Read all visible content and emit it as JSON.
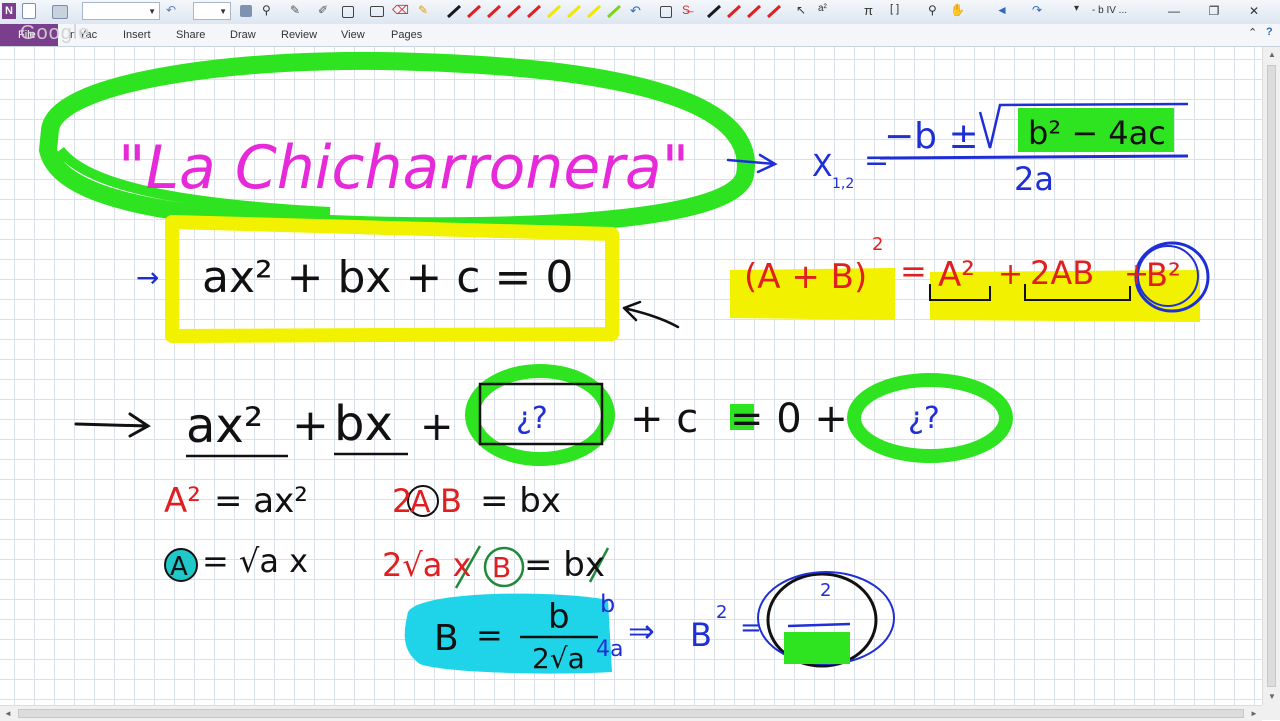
{
  "toolbar": {
    "app_icon": "onenote-icon",
    "window_title": "- b IV ...",
    "window_controls": [
      "minimize-icon",
      "restore-icon",
      "close-icon"
    ],
    "pen_colors": [
      "#1a1a1a",
      "#e02020",
      "#e02020",
      "#e02020",
      "#e02020",
      "#f2e600",
      "#f2e600",
      "#f2e600",
      "#7fd31a",
      "#1a1a1a",
      "#e02020",
      "#e02020",
      "#e02020"
    ]
  },
  "ribbon": {
    "file_label": "File",
    "tabs": [
      "Insert",
      "Share",
      "Draw",
      "Review",
      "View",
      "Pages"
    ],
    "overlay_watermark": "Google",
    "tab_partial": "n Yac",
    "controls": [
      "help-icon",
      "restore-icon",
      "close-icon"
    ]
  },
  "notes": {
    "title": "\"La Chicharronera\"",
    "formula": {
      "x_label": "X",
      "x_subscript": "1,2",
      "equals": "=",
      "numerator": "−b ±",
      "radicand": "b² − 4ac",
      "denominator": "2a"
    },
    "general_equation": {
      "arrow": "→",
      "text": "ax² + bx + c = 0"
    },
    "binomial_identity": {
      "left": "(A + B)",
      "left_exp": "2",
      "equals": "=",
      "term1": "A²",
      "plus1": "+",
      "term2": "2AB",
      "plus2": "+",
      "term3": "B²"
    },
    "completing_square": {
      "arrow": "→",
      "ax2": "ax²",
      "plus_bx": "+",
      "bx": "bx",
      "plus_q": "+",
      "question_1": "¿?",
      "plus_c": "+ c",
      "equals_zero": "= 0 +",
      "question_2": "¿?"
    },
    "derivation": {
      "a_squared": "A²",
      "eq_ax2": "= ax²",
      "two": "2",
      "a_circled": "A",
      "b_red": "B",
      "eq_bx": "= bx",
      "a_circled_2": "A",
      "eq_sqrt_ax": "= √a x",
      "two_sqrt_ax": "2√a x",
      "b_circled": "B",
      "eq_bx_2": "= bx",
      "b_result": "B",
      "eq": "=",
      "frac_num": "b",
      "frac_den": "2√a",
      "extra_b": "b",
      "extra_4a": "4a",
      "implies": "⇒",
      "b_sq": "B",
      "b_sq_exp": "2",
      "b_sq_eq": "=",
      "boxed_exp": "2"
    }
  }
}
